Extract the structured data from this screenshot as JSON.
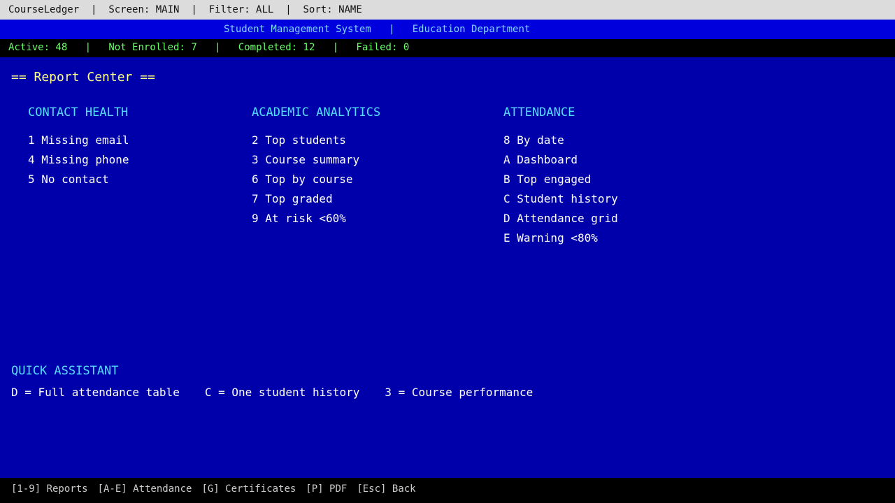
{
  "titlebar": {
    "app": "CourseLedger",
    "screen": "Screen: MAIN",
    "filter": "Filter: ALL",
    "sort": "Sort: NAME",
    "separator": "|"
  },
  "subtitle": {
    "system": "Student Management System",
    "department": "Education Department",
    "separator": "|"
  },
  "status": {
    "active": "Active: 48",
    "not_enrolled": "Not Enrolled: 7",
    "completed": "Completed: 12",
    "failed": "Failed: 0",
    "separator": "|"
  },
  "report_center": {
    "title": "== Report Center =="
  },
  "columns": [
    {
      "heading": "CONTACT HEALTH",
      "items": [
        "1 Missing email",
        "4 Missing phone",
        "5 No contact"
      ]
    },
    {
      "heading": "ACADEMIC ANALYTICS",
      "items": [
        "2 Top students",
        "3 Course summary",
        "6 Top by course",
        "7 Top graded",
        "9 At risk <60%"
      ]
    },
    {
      "heading": "ATTENDANCE",
      "items": [
        "8 By date",
        "A Dashboard",
        "B Top engaged",
        "C Student history",
        "D Attendance grid",
        "E Warning <80%"
      ]
    }
  ],
  "quick_assistant": {
    "title": "QUICK ASSISTANT",
    "items": [
      "D = Full attendance table",
      "C = One student history",
      "3 = Course performance"
    ]
  },
  "footer": {
    "keys": [
      "[1-9] Reports",
      "[A-E] Attendance",
      "[G] Certificates",
      "[P] PDF",
      "[Esc] Back"
    ]
  },
  "colors": {
    "background": "#0000aa",
    "header_band": "#0000dd",
    "status_text": "#66ff66",
    "heading_text": "#55ddff",
    "title_text": "#ffff88"
  }
}
